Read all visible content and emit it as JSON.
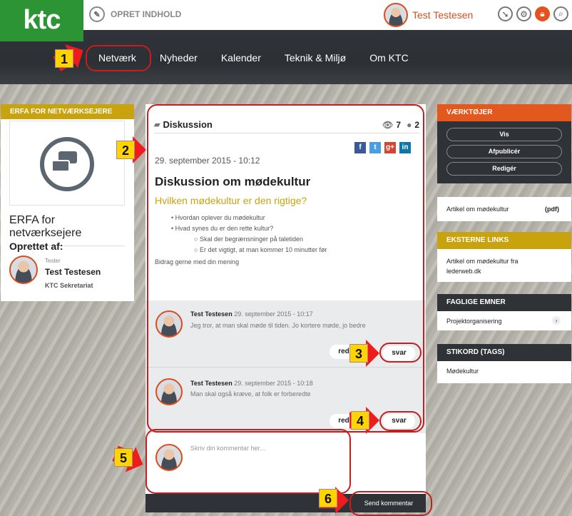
{
  "header": {
    "logo": "ktc",
    "create_label": "OPRET INDHOLD",
    "user_name": "Test Testesen"
  },
  "nav": {
    "items": [
      "Netværk",
      "Nyheder",
      "Kalender",
      "Teknik & Miljø",
      "Om KTC"
    ]
  },
  "left": {
    "section_title": "ERFA FOR NETVÆRKSEJERE",
    "group_name": "ERFA for netværksejere",
    "created_by_label": "Oprettet af:",
    "creator_role": "Tester",
    "creator_name": "Test Testesen",
    "creator_org": "KTC Sekretariat"
  },
  "discussion": {
    "type_label": "Diskussion",
    "views": "7",
    "comments": "2",
    "date": "29. september 2015 - 10:12",
    "title": "Diskussion om mødekultur",
    "subtitle": "Hvilken mødekultur er den rigtige?",
    "bullets": [
      "Hvordan oplever du mødekultur",
      "Hvad synes du er den rette kultur?"
    ],
    "sub_bullets": [
      "Skal der begrænsninger på taletiden",
      "Er det vigtigt, at man kommer 10 minutter før"
    ],
    "footer": "Bidrag gerne med din mening"
  },
  "comments": [
    {
      "author": "Test Testesen",
      "time": "29. september 2015 - 10:17",
      "text": "Jeg tror, at man skal møde til tiden. Jo kortere møde, jo bedre",
      "edit_label": "red",
      "reply_label": "svar"
    },
    {
      "author": "Test Testesen",
      "time": "29. september 2015 - 10:18",
      "text": "Man skal også kræve, at folk er forberedte",
      "edit_label": "red",
      "reply_label": "svar"
    }
  ],
  "composer": {
    "placeholder": "Skriv din kommentar her...",
    "submit_label": "Send kommentar"
  },
  "right": {
    "tools_title": "VÆRKTØJER",
    "tools": [
      "Vis",
      "Afpublicér",
      "Redigér"
    ],
    "attachment": "Artikel om mødekultur",
    "attachment_type": "(pdf)",
    "ext_title": "EKSTERNE LINKS",
    "ext_link": "Artikel om mødekultur fra lederweb.dk",
    "topics_title": "FAGLIGE EMNER",
    "topic": "Projektorganisering",
    "tags_title": "STIKORD (TAGS)",
    "tag": "Mødekultur"
  },
  "annotations": [
    "1",
    "2",
    "3",
    "4",
    "5",
    "6"
  ],
  "colors": {
    "accent": "#e3581c",
    "yellow": "#c9a30d",
    "green": "#2d9436",
    "dark": "#2f3236"
  }
}
